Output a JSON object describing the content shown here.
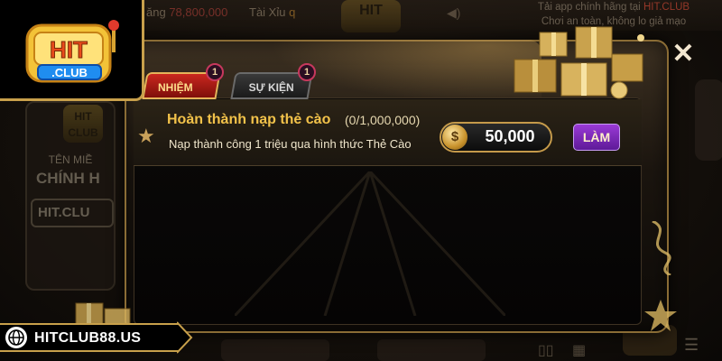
{
  "logo": {
    "brand": "HIT",
    "sub": ".CLUB"
  },
  "background": {
    "jackpot_label": "ăng",
    "jackpot_value": "78,800,000",
    "taixiu_label": "Tài Xỉu",
    "taixiu_suffix": "q",
    "promo_line1_prefix": "Tải app chính hãng tại",
    "promo_line1_brand": "HIT.CLUB",
    "promo_line2": "Chơi an toàn, không lo giả mạo",
    "left_panel_title": "TÊN MIỀ",
    "left_panel_subtitle": "CHÍNH H",
    "left_panel_button": "HIT.CLU",
    "mini_logo": "HIT CLUB"
  },
  "modal": {
    "tabs": [
      {
        "label": "NHIỆM VỤ",
        "badge": "1",
        "active": true
      },
      {
        "label": "SỰ KIỆN",
        "badge": "1",
        "active": false
      }
    ],
    "close_icon": "close-icon",
    "tasks": [
      {
        "title": "Hoàn thành nạp thẻ cào",
        "progress": "(0/1,000,000)",
        "description": "Nạp thành công 1 triệu qua hình thức Thẻ Cào",
        "reward": "50,000",
        "reward_coin_symbol": "$",
        "action_label": "LÀM"
      }
    ]
  },
  "footer": {
    "domain": "HITCLUB88.US"
  },
  "colors": {
    "gold": "#c8a04b",
    "task_title": "#f2c24a",
    "tab_active": "#c9271f",
    "action_button": "#7a2bb8"
  }
}
